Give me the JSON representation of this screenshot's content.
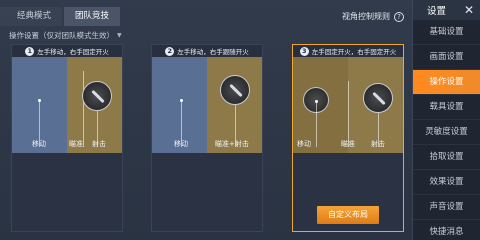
{
  "tabs": [
    {
      "label": "经典模式",
      "active": false
    },
    {
      "label": "团队竞技",
      "active": true
    }
  ],
  "view_control_label": "视角控制规则",
  "subtitle": "操作设置（仅对团队模式生效）",
  "cards": [
    {
      "num": "1",
      "title": "左手移动，右手固定开火",
      "labels": {
        "move": "移动",
        "aim": "瞄准",
        "fire": "射击"
      }
    },
    {
      "num": "2",
      "title": "左手移动，右手跟随开火",
      "labels": {
        "move": "移动",
        "aimfire": "瞄准+射击"
      }
    },
    {
      "num": "3",
      "title": "左手固定开火，右手固定开火",
      "labels": {
        "move": "移动",
        "aim": "瞄准",
        "fire": "射击"
      },
      "button": "自定义布局",
      "selected": true
    }
  ],
  "sidebar": {
    "title": "设置",
    "items": [
      {
        "label": "基础设置"
      },
      {
        "label": "画面设置"
      },
      {
        "label": "操作设置",
        "active": true
      },
      {
        "label": "载具设置"
      },
      {
        "label": "灵敏度设置"
      },
      {
        "label": "拾取设置"
      },
      {
        "label": "效果设置"
      },
      {
        "label": "声音设置"
      },
      {
        "label": "快捷消息"
      }
    ]
  },
  "colors": {
    "accent": "#f08a2a",
    "selected_border": "#f0a62a"
  }
}
